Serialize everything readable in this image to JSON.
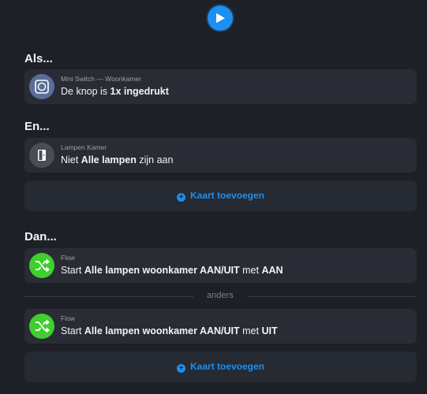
{
  "toolbar": {
    "play_icon": "play-icon",
    "accent": "#1d8ff0"
  },
  "sections": {
    "als": {
      "title": "Als...",
      "card": {
        "meta": "Mini Switch — Woonkamer",
        "title_pre": "De knop is ",
        "title_bold": "1x ingedrukt",
        "title_post": "",
        "icon": "switch-icon"
      }
    },
    "en": {
      "title": "En...",
      "card": {
        "meta": "Lampen Kamer",
        "title_pre": "Niet ",
        "title_bold": "Alle lampen",
        "title_post": " zijn aan",
        "icon": "door-icon"
      },
      "add_label": "Kaart toevoegen"
    },
    "dan": {
      "title": "Dan...",
      "cards": [
        {
          "meta": "Flow",
          "title_pre": "Start ",
          "title_bold": "Alle lampen woonkamer AAN/UIT",
          "title_mid": " met ",
          "title_bold2": "AAN",
          "icon": "shuffle-icon"
        },
        {
          "meta": "Flow",
          "title_pre": "Start ",
          "title_bold": "Alle lampen woonkamer AAN/UIT",
          "title_mid": " met ",
          "title_bold2": "UIT",
          "icon": "shuffle-icon"
        }
      ],
      "divider_label": "anders",
      "add_label": "Kaart toevoegen"
    }
  },
  "colors": {
    "flow_green": "#3fcf2f",
    "add_blue": "#1c8ff0"
  }
}
